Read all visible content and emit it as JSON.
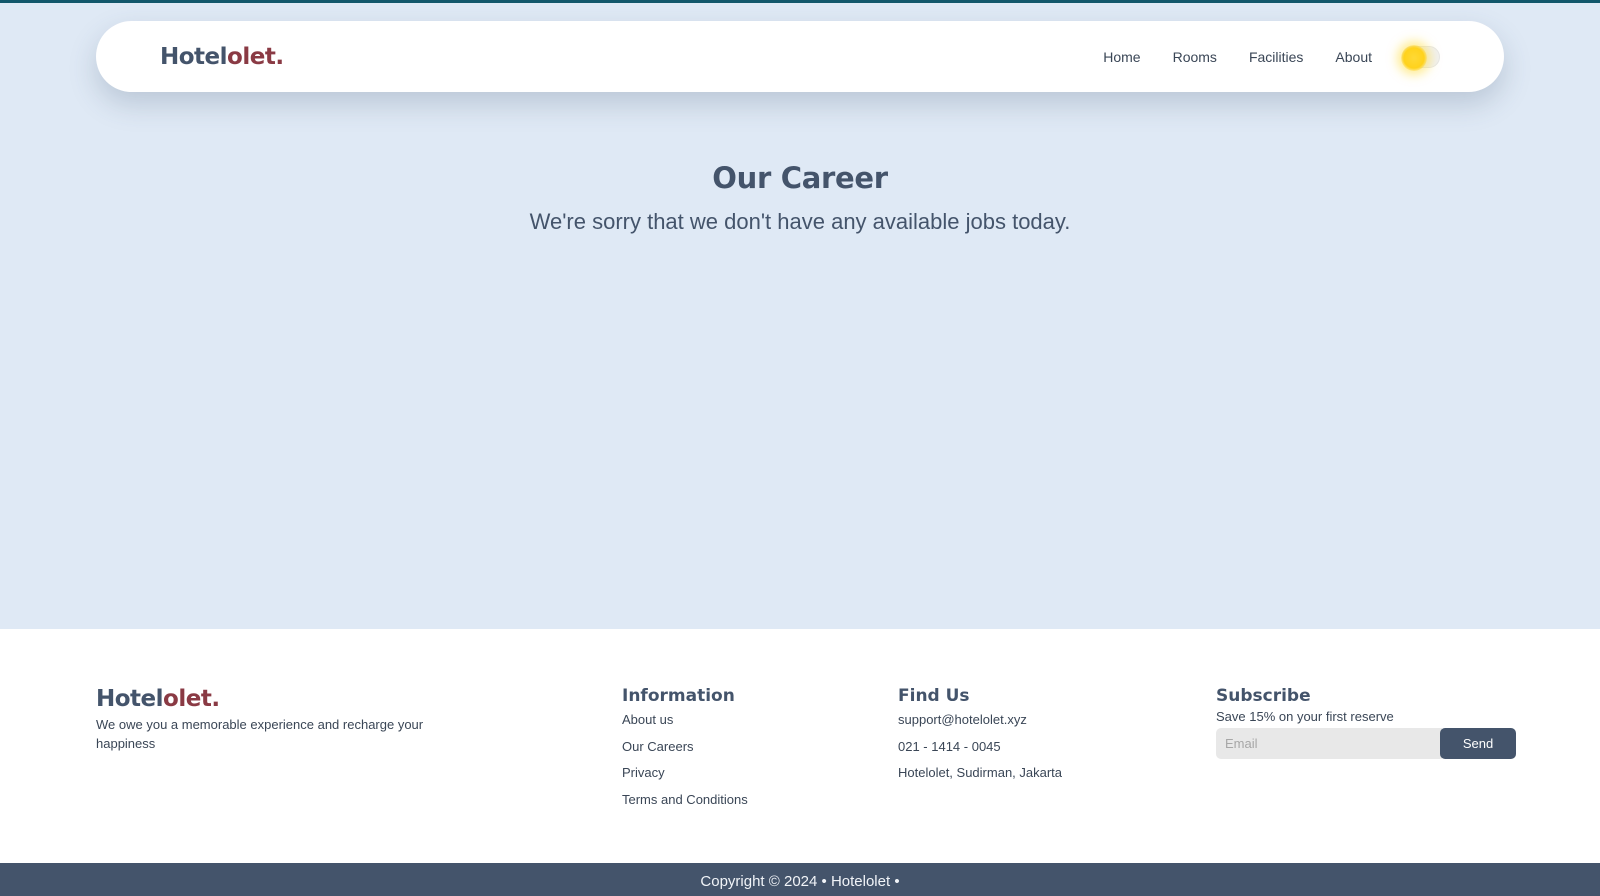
{
  "brand": {
    "part1": "Hotel",
    "part2": "olet",
    "dot": "."
  },
  "nav": {
    "links": [
      "Home",
      "Rooms",
      "Facilities",
      "About"
    ],
    "theme_toggle_icon": "sun-icon"
  },
  "main": {
    "title": "Our Career",
    "message": "We're sorry that we don't have any available jobs today."
  },
  "footer": {
    "tagline": "We owe you a memorable experience and recharge your happiness",
    "information": {
      "heading": "Information",
      "items": [
        "About us",
        "Our Careers",
        "Privacy",
        "Terms and Conditions"
      ]
    },
    "find_us": {
      "heading": "Find Us",
      "email": "support@hotelolet.xyz",
      "phone": "021 - 1414 - 0045",
      "address": "Hotelolet, Sudirman, Jakarta"
    },
    "subscribe": {
      "heading": "Subscribe",
      "text": "Save 15% on your first reserve",
      "placeholder": "Email",
      "button": "Send"
    }
  },
  "copyright": "Copyright © 2024 • Hotelolet •",
  "colors": {
    "background": "#dfe9f5",
    "primary": "#44546b",
    "accent": "#8a3a44",
    "sun": "#ffd21c"
  }
}
